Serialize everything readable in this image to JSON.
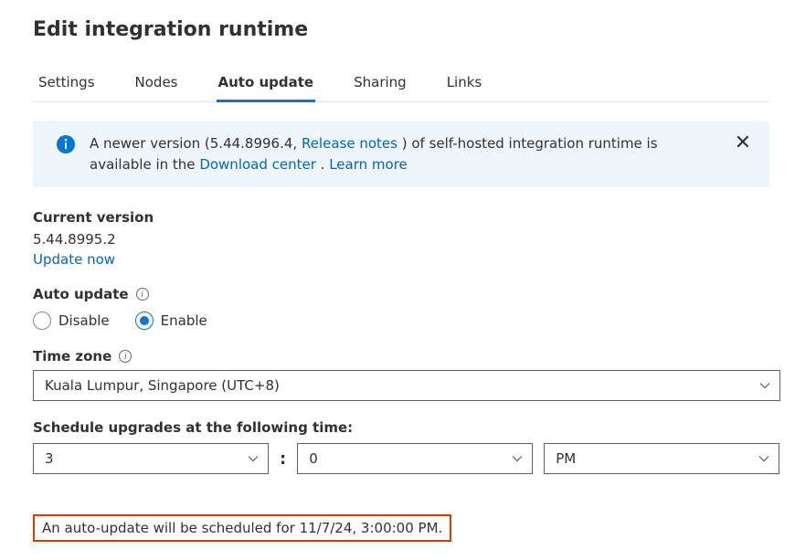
{
  "title": "Edit integration runtime",
  "tabs": [
    {
      "label": "Settings",
      "active": false
    },
    {
      "label": "Nodes",
      "active": false
    },
    {
      "label": "Auto update",
      "active": true
    },
    {
      "label": "Sharing",
      "active": false
    },
    {
      "label": "Links",
      "active": false
    }
  ],
  "banner": {
    "t1": "A newer version (5.44.8996.4, ",
    "release_notes": "Release notes",
    "t2": " ) of self-hosted integration runtime is available in the ",
    "download_center": "Download center",
    "t3": " . ",
    "learn_more": "Learn more"
  },
  "current_version": {
    "label": "Current version",
    "value": "5.44.8995.2",
    "update_now": "Update now"
  },
  "auto_update": {
    "label": "Auto update",
    "options": {
      "disable": "Disable",
      "enable": "Enable"
    },
    "selected": "enable"
  },
  "timezone": {
    "label": "Time zone",
    "value": "Kuala Lumpur, Singapore (UTC+8)"
  },
  "schedule": {
    "label": "Schedule upgrades at the following time:",
    "hour": "3",
    "minute": "0",
    "ampm": "PM"
  },
  "footer_note": "An auto-update will be scheduled for 11/7/24, 3:00:00 PM."
}
